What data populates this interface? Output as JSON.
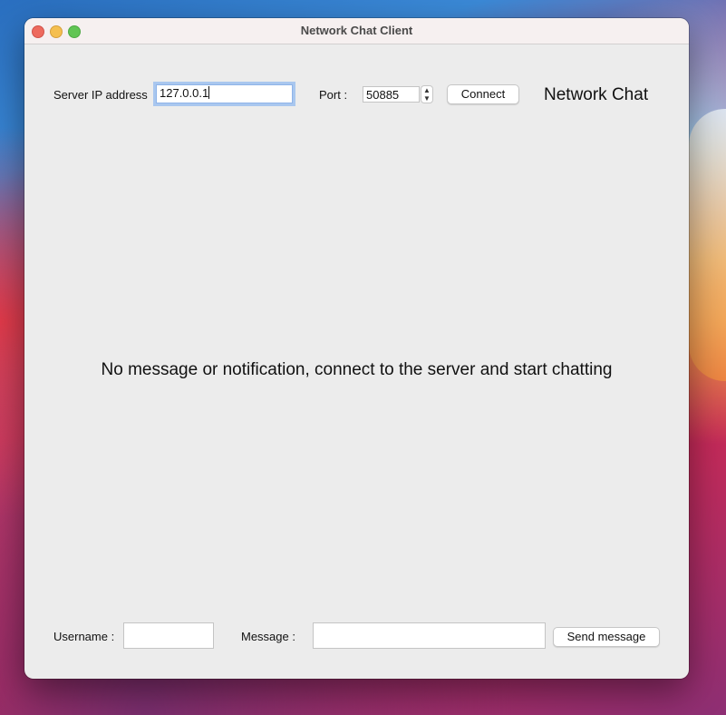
{
  "window": {
    "title": "Network Chat Client"
  },
  "connection": {
    "server_ip_label": "Server IP address",
    "server_ip_value": "127.0.0.1",
    "port_label": "Port :",
    "port_value": "50885",
    "connect_label": "Connect",
    "brand_label": "Network Chat"
  },
  "chat": {
    "empty_message": "No message or notification, connect to the server and start chatting"
  },
  "composer": {
    "username_label": "Username :",
    "username_value": "",
    "message_label": "Message :",
    "message_value": "",
    "send_label": "Send message"
  },
  "icons": {
    "window_controls": [
      "close-icon",
      "minimize-icon",
      "maximize-icon"
    ],
    "stepper": [
      "chevron-up-icon",
      "chevron-down-icon"
    ]
  },
  "colors": {
    "close": "#ed6a5e",
    "minimize": "#f5bf4f",
    "maximize": "#61c554",
    "focus_ring": "#a9c7ef",
    "window_background": "#ececec"
  }
}
